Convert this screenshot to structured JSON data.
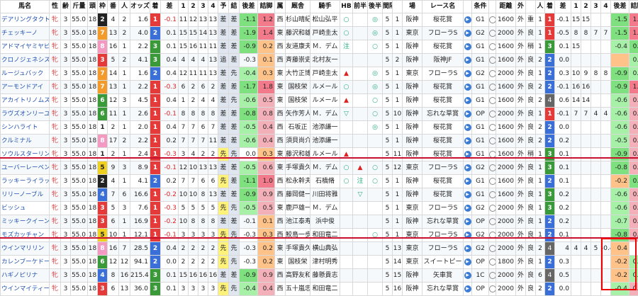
{
  "headers": [
    "馬名",
    "性",
    "齢",
    "斤量",
    "頭",
    "枠",
    "番",
    "人",
    "オッズ",
    "着",
    "差",
    "1",
    "2",
    "3",
    "4",
    "予",
    "結",
    "後差",
    "詰脚",
    "属",
    "厩舎",
    "騎手",
    "HB",
    "前半",
    "後半",
    "間隔",
    "",
    "場",
    "レース名",
    "",
    "条件",
    "",
    "距離",
    "外",
    "",
    "人",
    "着",
    "差",
    "1",
    "2",
    "3",
    "4",
    "後差",
    "詰脚"
  ],
  "rows": [
    [
      "デアリングタクト",
      "牝",
      "3",
      "55.0",
      "18",
      "2",
      "4",
      "2",
      "1.6",
      "1",
      "-0.1",
      "11",
      "12",
      "13",
      "13",
      "差",
      "差",
      "-1.1",
      "1.2",
      "西",
      "杉山晴紀",
      "松山弘平",
      "○",
      "",
      "◎",
      "5",
      "1",
      "阪神",
      "桜花賞",
      "",
      "G1",
      "",
      "1600",
      "外",
      "重",
      "1",
      "1",
      "-0.1",
      "15",
      "15",
      "",
      "",
      "-1.5",
      "1.7"
    ],
    [
      "チェッキーノ",
      "牝",
      "3",
      "55.0",
      "18",
      "7",
      "13",
      "2",
      "4.0",
      "2",
      "0.1",
      "15",
      "15",
      "14",
      "13",
      "差",
      "差",
      "-1.9",
      "1.4",
      "東",
      "藤沢和雄",
      "戸崎圭太",
      "○",
      "",
      "◎",
      "5",
      "1",
      "東京",
      "フローラS",
      "",
      "G2",
      "",
      "2000",
      "外",
      "良",
      "1",
      "1",
      "-0.5",
      "8",
      "8",
      "7",
      "7",
      "-1.5",
      "1.3"
    ],
    [
      "アドマイヤミヤビ",
      "牝",
      "3",
      "55.0",
      "18",
      "8",
      "16",
      "1",
      "2.2",
      "3",
      "0.1",
      "15",
      "16",
      "11",
      "11",
      "差",
      "差",
      "-0.9",
      "0.2",
      "西",
      "友道康夫",
      "Ｍ．デム",
      "注",
      "",
      "○",
      "5",
      "1",
      "阪神",
      "桜花賞",
      "",
      "G1",
      "",
      "1600",
      "外",
      "稍",
      "1",
      "3",
      "0.1",
      "15",
      "",
      "",
      "",
      "-0.4",
      "0.0"
    ],
    [
      "クロノジェネシス",
      "牝",
      "3",
      "55.0",
      "18",
      "3",
      "5",
      "2",
      "4.1",
      "3",
      "0.4",
      "4",
      "4",
      "4",
      "13",
      "追",
      "差",
      "-0.3",
      "0.1",
      "西",
      "斉藤崇史",
      "北村友一",
      "",
      "",
      "",
      "5",
      "2",
      "阪神",
      "阪神JF",
      "",
      "G1",
      "",
      "1600",
      "外",
      "良",
      "2",
      "2",
      "0.0",
      "",
      "",
      "",
      "",
      "",
      "0.4"
    ],
    [
      "ルージュバック",
      "牝",
      "3",
      "55.0",
      "18",
      "7",
      "14",
      "1",
      "1.6",
      "2",
      "0.4",
      "12",
      "11",
      "11",
      "13",
      "差",
      "先",
      "-0.4",
      "0.3",
      "東",
      "大竹正博",
      "戸崎圭太",
      "▲",
      "",
      "◎",
      "5",
      "1",
      "東京",
      "フローラS",
      "",
      "G2",
      "",
      "2000",
      "外",
      "良",
      "1",
      "2",
      "0.3",
      "10",
      "9",
      "8",
      "8",
      "-0.9",
      "0.4"
    ],
    [
      "アーモンドアイ",
      "牝",
      "3",
      "55.0",
      "18",
      "7",
      "13",
      "1",
      "2.2",
      "1",
      "-0.3",
      "6",
      "2",
      "6",
      "2",
      "差",
      "差",
      "-1.7",
      "1.8",
      "東",
      "国枝栄",
      "ルメール",
      "○",
      "",
      "◎",
      "5",
      "1",
      "阪神",
      "桜花賞",
      "",
      "G1",
      "",
      "1600",
      "外",
      "良",
      "2",
      "2",
      "-0.1",
      "16",
      "16",
      "",
      "",
      "-0.9",
      "1.3"
    ],
    [
      "アカイトリノムスメ",
      "牝",
      "3",
      "55.0",
      "18",
      "6",
      "12",
      "3",
      "4.5",
      "1",
      "0.4",
      "1",
      "2",
      "4",
      "4",
      "差",
      "先",
      "-0.6",
      "0.5",
      "東",
      "国枝栄",
      "ルメール",
      "▲",
      "",
      "○",
      "5",
      "1",
      "阪神",
      "桜花賞",
      "",
      "G1",
      "",
      "1600",
      "外",
      "良",
      "2",
      "4",
      "0.6",
      "14",
      "14",
      "",
      "",
      "-0.6",
      "0.8"
    ],
    [
      "ラヴズオンリーユー",
      "牝",
      "3",
      "55.0",
      "18",
      "6",
      "11",
      "1",
      "2.6",
      "1",
      "-0.1",
      "8",
      "8",
      "8",
      "8",
      "差",
      "差",
      "-0.8",
      "0.8",
      "西",
      "矢作芳人",
      "Ｍ．デム",
      "▽",
      "",
      "○",
      "5",
      "10",
      "阪神",
      "忘れな草賞",
      "",
      "OP",
      "",
      "2000",
      "外",
      "良",
      "1",
      "1",
      "-0.1",
      "7",
      "7",
      "4",
      "4",
      "-0.6",
      "0.6"
    ],
    [
      "シンハライト",
      "牝",
      "3",
      "55.0",
      "18",
      "1",
      "2",
      "1",
      "2.0",
      "1",
      "0.4",
      "7",
      "7",
      "6",
      "7",
      "差",
      "差",
      "-0.5",
      "0.4",
      "西",
      "石坂正",
      "池添謙一",
      "",
      "",
      "◎",
      "5",
      "1",
      "阪神",
      "桜花賞",
      "",
      "G1",
      "",
      "1600",
      "外",
      "良",
      "2",
      "2",
      "0.0",
      "",
      "",
      "",
      "",
      "-0.6",
      "0.6"
    ],
    [
      "クルミナル",
      "牝",
      "3",
      "55.0",
      "18",
      "8",
      "17",
      "2",
      "2.2",
      "1",
      "0.2",
      "7",
      "7",
      "7",
      "11",
      "差",
      "差",
      "-0.6",
      "0.4",
      "西",
      "須貝尚介",
      "池添謙一",
      "",
      "",
      "",
      "5",
      "1",
      "阪神",
      "桜花賞",
      "",
      "G1",
      "",
      "1600",
      "外",
      "良",
      "2",
      "2",
      "0.2",
      "",
      "",
      "",
      "",
      "-0.5",
      "0.5"
    ],
    [
      "ソウルスターリング",
      "牝",
      "3",
      "55.0",
      "18",
      "1",
      "2",
      "1",
      "2.4",
      "1",
      "-0.3",
      "3",
      "4",
      "2",
      "2",
      "先",
      "先",
      "0.0",
      "0.3",
      "東",
      "藤沢和雄",
      "ルメール",
      "▲",
      "",
      "",
      "5",
      "11",
      "阪神",
      "桜花賞",
      "",
      "G1",
      "",
      "1600",
      "外",
      "稍",
      "1",
      "3",
      "0.1",
      "",
      "",
      "",
      "",
      "-0.9",
      "0.8"
    ],
    [
      "ユーバーレーベン",
      "牝",
      "3",
      "55.0",
      "18",
      "5",
      "9",
      "3",
      "8.9",
      "1",
      "-0.1",
      "12",
      "10",
      "13",
      "13",
      "差",
      "差",
      "-0.5",
      "0.6",
      "東",
      "手塚貴久",
      "Ｍ．デム",
      "○",
      "▲",
      "○",
      "5",
      "12",
      "東京",
      "フローラS",
      "",
      "G2",
      "",
      "2000",
      "外",
      "良",
      "1",
      "3",
      "0.1",
      "",
      "",
      "",
      "",
      "-0.8",
      "0.6"
    ],
    [
      "ラッキーライラック",
      "牝",
      "3",
      "55.0",
      "18",
      "2",
      "4",
      "1",
      "4.1",
      "2",
      "0.2",
      "7",
      "7",
      "6",
      "6",
      "先",
      "差",
      "-1.1",
      "1.0",
      "西",
      "松永幹夫",
      "石橋脩",
      "○",
      "注",
      "○",
      "5",
      "1",
      "阪神",
      "桜花賞",
      "",
      "G1",
      "",
      "1600",
      "外",
      "良",
      "1",
      "2",
      "0.1",
      "",
      "",
      "",
      "",
      "-0.2",
      "0.1"
    ],
    [
      "リリーノーブル",
      "牝",
      "3",
      "55.0",
      "18",
      "4",
      "7",
      "6",
      "16.6",
      "1",
      "-0.2",
      "10",
      "10",
      "8",
      "13",
      "差",
      "差",
      "-0.9",
      "0.9",
      "西",
      "藤岡健一",
      "川田将雅",
      "",
      "▽",
      "",
      "5",
      "1",
      "阪神",
      "桜花賞",
      "",
      "G1",
      "",
      "1600",
      "外",
      "良",
      "1",
      "3",
      "0.2",
      "",
      "",
      "",
      "",
      "-0.6",
      "0.5"
    ],
    [
      "ビッシュ",
      "牝",
      "3",
      "55.0",
      "18",
      "3",
      "5",
      "3",
      "7.6",
      "1",
      "-0.3",
      "5",
      "5",
      "5",
      "5",
      "先",
      "先",
      "-0.5",
      "0.5",
      "東",
      "鹿戸雄一",
      "Ｍ．デム",
      "",
      "",
      "",
      "5",
      "1",
      "東京",
      "フローラS",
      "",
      "G2",
      "",
      "2000",
      "外",
      "良",
      "1",
      "3",
      "0.2",
      "",
      "",
      "",
      "",
      "-0.6",
      "0.5"
    ],
    [
      "ミッキークイーン",
      "牝",
      "3",
      "55.0",
      "18",
      "3",
      "6",
      "1",
      "16.9",
      "1",
      "-0.2",
      "10",
      "8",
      "8",
      "8",
      "差",
      "差",
      "-0.1",
      "0.1",
      "西",
      "池江泰寿",
      "浜中俊",
      "",
      "",
      "",
      "5",
      "1",
      "阪神",
      "忘れな草賞",
      "",
      "OP",
      "",
      "2000",
      "外",
      "良",
      "1",
      "2",
      "0.2",
      "",
      "",
      "",
      "",
      "-0.7",
      "0.8"
    ],
    [
      "モズカッチャン",
      "牝",
      "3",
      "55.0",
      "18",
      "5",
      "10",
      "1",
      "12.1",
      "1",
      "-0.1",
      "3",
      "3",
      "3",
      "3",
      "先",
      "先",
      "-0.3",
      "0.3",
      "西",
      "鮫島一歩",
      "和田竜二",
      "",
      "",
      "○",
      "5",
      "1",
      "東京",
      "フローラS",
      "",
      "G2",
      "",
      "2000",
      "外",
      "良",
      "1",
      "2",
      "0.1",
      "",
      "",
      "",
      "",
      "-0.8",
      "0.8"
    ],
    [
      "ウインマリリン",
      "牝",
      "3",
      "55.0",
      "18",
      "8",
      "16",
      "7",
      "28.5",
      "2",
      "0.4",
      "2",
      "2",
      "2",
      "2",
      "先",
      "先",
      "-0.3",
      "0.2",
      "東",
      "手塚貴久",
      "横山典弘",
      "",
      "",
      "",
      "5",
      "13",
      "東京",
      "フローラS",
      "",
      "G2",
      "",
      "2000",
      "外",
      "良",
      "2",
      "4",
      "4",
      "4",
      "4",
      "5",
      "-0.4",
      "0.4"
    ],
    [
      "カレンブーケドール",
      "牝",
      "3",
      "55.0",
      "18",
      "6",
      "12",
      "12",
      "94.1",
      "2",
      "0.0",
      "2",
      "2",
      "2",
      "2",
      "先",
      "先",
      "-0.3",
      "0.2",
      "東",
      "国枝栄",
      "津村明秀",
      "",
      "",
      "",
      "5",
      "14",
      "東京",
      "スイートピー",
      "",
      "OP",
      "",
      "1800",
      "外",
      "良",
      "1",
      "2",
      "0.3",
      "",
      "",
      "",
      "",
      "-0.2",
      "0.3"
    ],
    [
      "ハギノピリナ",
      "牝",
      "3",
      "55.0",
      "18",
      "4",
      "8",
      "16",
      "215.4",
      "3",
      "0.1",
      "15",
      "16",
      "16",
      "16",
      "差",
      "差",
      "-0.9",
      "0.9",
      "西",
      "高野友和",
      "藤懸貴志",
      "",
      "",
      "",
      "5",
      "15",
      "阪神",
      "矢車賞",
      "",
      "1C",
      "",
      "2000",
      "外",
      "良",
      "6",
      "4",
      "0.5",
      "",
      "",
      "",
      "",
      "-0.2",
      "0.3"
    ],
    [
      "ウインマイティー",
      "牝",
      "3",
      "55.0",
      "18",
      "3",
      "6",
      "13",
      "36.0",
      "3",
      "0.1",
      "3",
      "3",
      "3",
      "3",
      "先",
      "先",
      "-0.4",
      "0.4",
      "西",
      "五十嵐忠",
      "和田竜二",
      "",
      "",
      "",
      "5",
      "16",
      "阪神",
      "忘れな草賞",
      "",
      "OP",
      "",
      "2000",
      "外",
      "良",
      "2",
      "2",
      "0.0",
      "",
      "",
      "",
      "",
      "-0.4",
      "0.6"
    ]
  ],
  "colors": {
    "accent_red": "#e53a3a",
    "frame_divider": "#c8102e",
    "highlight_pink": "#f4b0b8",
    "highlight_green": "#7ee07e"
  }
}
